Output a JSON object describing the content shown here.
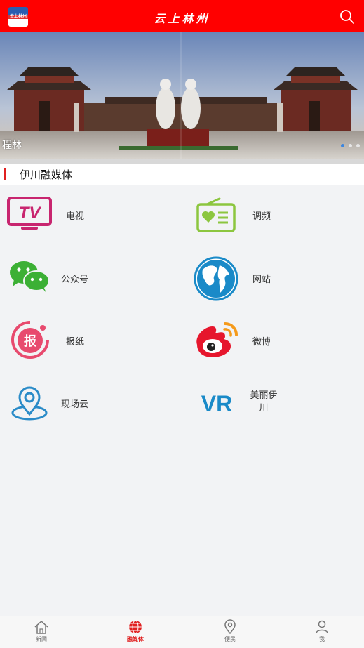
{
  "header": {
    "logo_text": "云上林州",
    "title": "云上林州"
  },
  "banner": {
    "caption": "程林",
    "slides_count": 3,
    "active_slide": 1
  },
  "section": {
    "title": "伊川融媒体"
  },
  "media_items": [
    {
      "label": "电视",
      "icon": "tv-icon"
    },
    {
      "label": "调频",
      "icon": "radio-icon"
    },
    {
      "label": "公众号",
      "icon": "wechat-icon"
    },
    {
      "label": "网站",
      "icon": "globe-icon"
    },
    {
      "label": "报纸",
      "icon": "newspaper-icon"
    },
    {
      "label": "微博",
      "icon": "weibo-icon"
    },
    {
      "label": "现场云",
      "icon": "location-cloud-icon"
    },
    {
      "label": "美丽伊川",
      "icon": "vr-icon"
    }
  ],
  "tabbar": {
    "items": [
      {
        "label": "新闻",
        "icon": "home-icon"
      },
      {
        "label": "融媒体",
        "icon": "globe-icon"
      },
      {
        "label": "便民",
        "icon": "map-pin-icon"
      },
      {
        "label": "我",
        "icon": "user-icon"
      }
    ],
    "active_index": 1
  },
  "colors": {
    "brand_red": "#ff0000",
    "tv_pink": "#c8256f",
    "radio_green": "#8cc63f",
    "wechat_green": "#3cb035",
    "globe_blue": "#1a8ac8",
    "paper_pink": "#e84a6e",
    "weibo_red": "#e6162d",
    "cloud_blue": "#2a8bc8",
    "vr_blue": "#1a8ac8"
  }
}
